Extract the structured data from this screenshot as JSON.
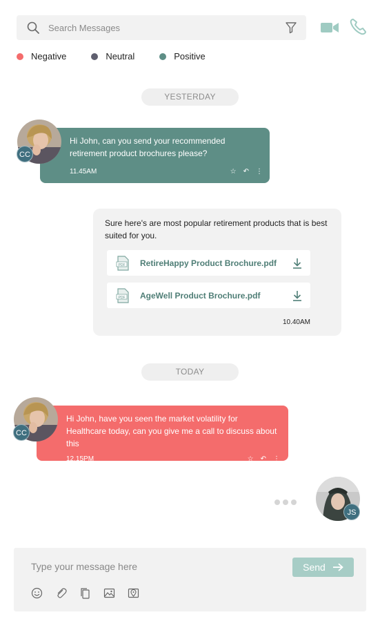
{
  "search": {
    "placeholder": "Search Messages"
  },
  "legend": [
    {
      "label": "Negative",
      "color": "#f46c6c"
    },
    {
      "label": "Neutral",
      "color": "#5f5f6f"
    },
    {
      "label": "Positive",
      "color": "#5e8e86"
    }
  ],
  "dates": {
    "yesterday": "YESTERDAY",
    "today": "TODAY"
  },
  "messages": {
    "m1": {
      "initials": "CC",
      "text": "Hi John, can you send your recommended retirement product brochures please?",
      "time": "11.45AM",
      "sentiment_color": "#5e8e86"
    },
    "m2": {
      "text": "Sure here's are most popular retirement products that is best suited for you.",
      "files": [
        {
          "name": "RetireHappy Product Brochure.pdf"
        },
        {
          "name": "AgeWell Product Brochure.pdf"
        }
      ],
      "time": "10.40AM"
    },
    "m3": {
      "initials": "CC",
      "text": "Hi John, have you seen the market volatility for Healthcare today, can you give me a call to discuss about this",
      "time": "12.15PM",
      "sentiment_color": "#f46c6c"
    },
    "typing_user": {
      "initials": "JS"
    }
  },
  "composer": {
    "placeholder": "Type your message here",
    "send_label": "Send"
  },
  "icons": {
    "search": "search-icon",
    "filter": "filter-icon",
    "video": "video-camera-icon",
    "phone": "phone-icon",
    "star": "star-icon",
    "reply": "reply-icon",
    "more": "more-vertical-icon",
    "pdf": "pdf-file-icon",
    "download": "download-icon",
    "emoji": "emoji-icon",
    "attach": "paperclip-icon",
    "copy": "copy-icon",
    "image": "image-icon",
    "location": "map-icon",
    "arrow": "arrow-right-icon"
  }
}
